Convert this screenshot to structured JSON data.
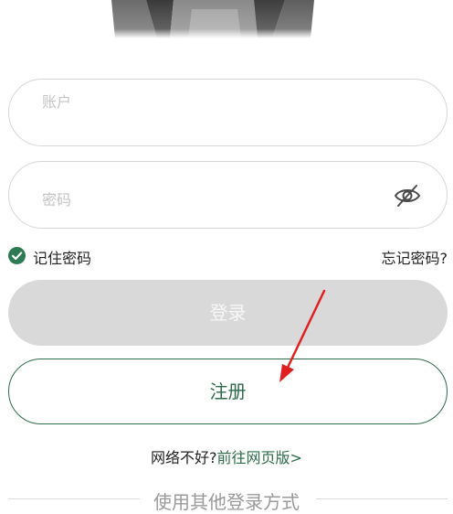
{
  "form": {
    "account_placeholder": "账户",
    "password_placeholder": "密码",
    "remember_label": "记住密码",
    "forgot_label": "忘记密码?",
    "login_label": "登录",
    "register_label": "注册"
  },
  "network": {
    "prefix": "网络不好?",
    "link": "前往网页版>"
  },
  "other_login": {
    "label": "使用其他登录方式"
  },
  "colors": {
    "accent": "#2e6b4c",
    "check": "#2e7a52",
    "login_disabled_bg": "#d9d9d9",
    "annotation_arrow": "#e02020"
  },
  "icons": {
    "eye": "eye-hidden-icon",
    "check": "check-circle-icon"
  }
}
